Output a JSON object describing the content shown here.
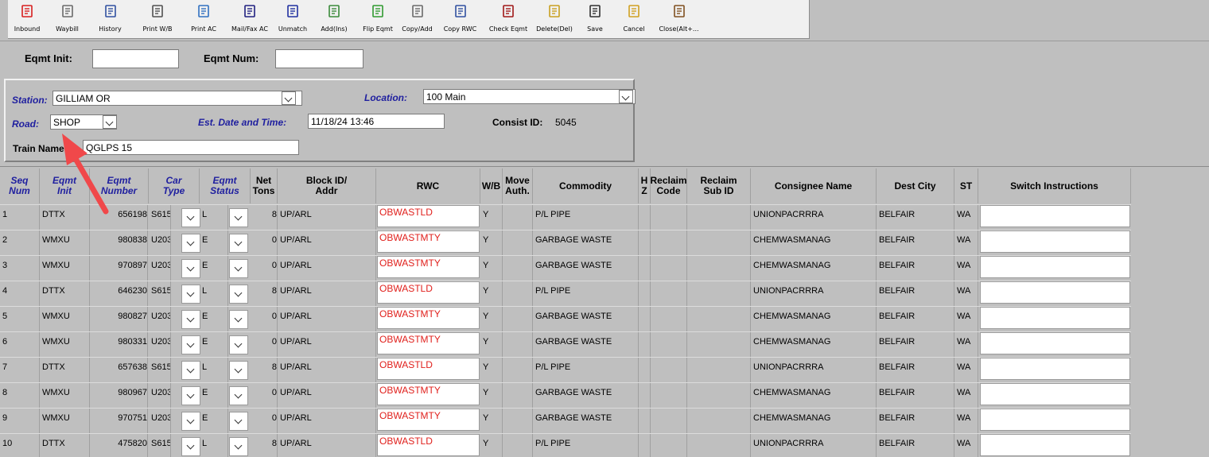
{
  "toolbar": {
    "items": [
      {
        "label": "Inbound",
        "icon": "check-mark-icon",
        "color": "#d81e1e"
      },
      {
        "label": "Waybill",
        "icon": "document-icon",
        "color": "#6a6a6a"
      },
      {
        "label": "History",
        "icon": "list-icon",
        "color": "#3050a0"
      },
      {
        "label": "Print W/B",
        "icon": "print-form-icon",
        "color": "#505050"
      },
      {
        "label": "Print AC",
        "icon": "printer-icon",
        "color": "#3070c0"
      },
      {
        "label": "Mail/Fax AC",
        "icon": "mail-icon",
        "color": "#202080"
      },
      {
        "label": "Unmatch",
        "icon": "unmatch-icon",
        "color": "#2030a0"
      },
      {
        "label": "Add(Ins)",
        "icon": "add-icon",
        "color": "#3a8a3a"
      },
      {
        "label": "Flip Eqmt",
        "icon": "flip-icon",
        "color": "#2f9a2f"
      },
      {
        "label": "Copy/Add",
        "icon": "copy-icon",
        "color": "#6a6a6a"
      },
      {
        "label": "Copy RWC",
        "icon": "copy-rwc-icon",
        "color": "#3050a0"
      },
      {
        "label": "Check Eqmt",
        "icon": "check-eqmt-icon",
        "color": "#a01818"
      },
      {
        "label": "Delete(Del)",
        "icon": "eraser-icon",
        "color": "#c9a020"
      },
      {
        "label": "Save",
        "icon": "save-icon",
        "color": "#303030"
      },
      {
        "label": "Cancel",
        "icon": "cancel-icon",
        "color": "#d0a020"
      },
      {
        "label": "Close(Alt+...",
        "icon": "exit-icon",
        "color": "#805020"
      }
    ]
  },
  "eqmt": {
    "init_label": "Eqmt Init:",
    "init_value": "",
    "num_label": "Eqmt Num:",
    "num_value": ""
  },
  "info": {
    "station_label": "Station:",
    "station_value": "GILLIAM OR",
    "location_label": "Location:",
    "location_value": "100 Main",
    "road_label": "Road:",
    "road_value": "SHOP",
    "est_label": "Est. Date and Time:",
    "est_value": "11/18/24 13:46",
    "consist_label": "Consist ID:",
    "consist_value": "5045",
    "train_label": "Train Name:",
    "train_value": "QGLPS 15"
  },
  "grid": {
    "headers": [
      {
        "line1": "Seq",
        "line2": "Num",
        "blue": true
      },
      {
        "line1": "Eqmt",
        "line2": "Init",
        "blue": true
      },
      {
        "line1": "Eqmt",
        "line2": "Number",
        "blue": true
      },
      {
        "line1": "Car",
        "line2": "Type",
        "blue": true
      },
      {
        "line1": "Eqmt",
        "line2": "Status",
        "blue": true
      },
      {
        "line1": "Net",
        "line2": "Tons",
        "blue": false
      },
      {
        "line1": "Block ID/",
        "line2": "Addr",
        "blue": false
      },
      {
        "line1": "RWC",
        "line2": "",
        "blue": false
      },
      {
        "line1": "W/B",
        "line2": "",
        "blue": false
      },
      {
        "line1": "Move",
        "line2": "Auth.",
        "blue": false
      },
      {
        "line1": "Commodity",
        "line2": "",
        "blue": false
      },
      {
        "line1": "H",
        "line2": "Z",
        "blue": false
      },
      {
        "line1": "Reclaim",
        "line2": "Code",
        "blue": false
      },
      {
        "line1": "Reclaim",
        "line2": "Sub ID",
        "blue": false
      },
      {
        "line1": "Consignee Name",
        "line2": "",
        "blue": false
      },
      {
        "line1": "Dest City",
        "line2": "",
        "blue": false
      },
      {
        "line1": "ST",
        "line2": "",
        "blue": false
      },
      {
        "line1": "Switch Instructions",
        "line2": "",
        "blue": false
      }
    ],
    "rows": [
      {
        "seq": "1",
        "init": "DTTX",
        "number": "656198",
        "car_type": "S615",
        "status": "L",
        "tons": "8",
        "block": "UP/ARL",
        "rwc": "OBWASTLD",
        "wb": "Y",
        "commodity": "P/L PIPE",
        "consignee": "UNIONPACRRRA",
        "city": "BELFAIR",
        "st": "WA"
      },
      {
        "seq": "2",
        "init": "WMXU",
        "number": "980838",
        "car_type": "U203",
        "status": "E",
        "tons": "0",
        "block": "UP/ARL",
        "rwc": "OBWASTMTY",
        "wb": "Y",
        "commodity": "GARBAGE WASTE",
        "consignee": "CHEMWASMANAG",
        "city": "BELFAIR",
        "st": "WA"
      },
      {
        "seq": "3",
        "init": "WMXU",
        "number": "970897",
        "car_type": "U203",
        "status": "E",
        "tons": "0",
        "block": "UP/ARL",
        "rwc": "OBWASTMTY",
        "wb": "Y",
        "commodity": "GARBAGE WASTE",
        "consignee": "CHEMWASMANAG",
        "city": "BELFAIR",
        "st": "WA"
      },
      {
        "seq": "4",
        "init": "DTTX",
        "number": "646230",
        "car_type": "S615",
        "status": "L",
        "tons": "8",
        "block": "UP/ARL",
        "rwc": "OBWASTLD",
        "wb": "Y",
        "commodity": "P/L PIPE",
        "consignee": "UNIONPACRRRA",
        "city": "BELFAIR",
        "st": "WA"
      },
      {
        "seq": "5",
        "init": "WMXU",
        "number": "980827",
        "car_type": "U203",
        "status": "E",
        "tons": "0",
        "block": "UP/ARL",
        "rwc": "OBWASTMTY",
        "wb": "Y",
        "commodity": "GARBAGE WASTE",
        "consignee": "CHEMWASMANAG",
        "city": "BELFAIR",
        "st": "WA"
      },
      {
        "seq": "6",
        "init": "WMXU",
        "number": "980331",
        "car_type": "U203",
        "status": "E",
        "tons": "0",
        "block": "UP/ARL",
        "rwc": "OBWASTMTY",
        "wb": "Y",
        "commodity": "GARBAGE WASTE",
        "consignee": "CHEMWASMANAG",
        "city": "BELFAIR",
        "st": "WA"
      },
      {
        "seq": "7",
        "init": "DTTX",
        "number": "657638",
        "car_type": "S615",
        "status": "L",
        "tons": "8",
        "block": "UP/ARL",
        "rwc": "OBWASTLD",
        "wb": "Y",
        "commodity": "P/L PIPE",
        "consignee": "UNIONPACRRRA",
        "city": "BELFAIR",
        "st": "WA"
      },
      {
        "seq": "8",
        "init": "WMXU",
        "number": "980967",
        "car_type": "U203",
        "status": "E",
        "tons": "0",
        "block": "UP/ARL",
        "rwc": "OBWASTMTY",
        "wb": "Y",
        "commodity": "GARBAGE WASTE",
        "consignee": "CHEMWASMANAG",
        "city": "BELFAIR",
        "st": "WA"
      },
      {
        "seq": "9",
        "init": "WMXU",
        "number": "970751",
        "car_type": "U203",
        "status": "E",
        "tons": "0",
        "block": "UP/ARL",
        "rwc": "OBWASTMTY",
        "wb": "Y",
        "commodity": "GARBAGE WASTE",
        "consignee": "CHEMWASMANAG",
        "city": "BELFAIR",
        "st": "WA"
      },
      {
        "seq": "10",
        "init": "DTTX",
        "number": "475820",
        "car_type": "S615",
        "status": "L",
        "tons": "8",
        "block": "UP/ARL",
        "rwc": "OBWASTLD",
        "wb": "Y",
        "commodity": "P/L PIPE",
        "consignee": "UNIONPACRRRA",
        "city": "BELFAIR",
        "st": "WA"
      }
    ]
  },
  "colors": {
    "label_blue": "#1f1f9f",
    "rwc_red": "#e0201c",
    "annotation_arrow": "#f0484a"
  }
}
